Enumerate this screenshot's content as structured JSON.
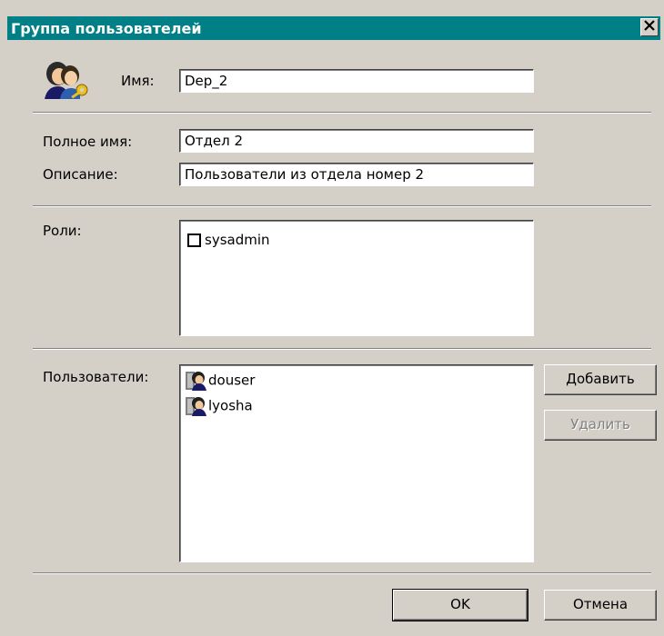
{
  "window": {
    "title": "Группа пользователей",
    "close_label": "×"
  },
  "form": {
    "name_label": "Имя:",
    "name_value": "Dep_2",
    "fullname_label": "Полное имя:",
    "fullname_value": "Отдел 2",
    "description_label": "Описание:",
    "description_value": "Пользователи из отдела номер 2",
    "roles_label": "Роли:",
    "roles": [
      {
        "label": "sysadmin",
        "checked": false
      }
    ],
    "users_label": "Пользователи:",
    "users": [
      {
        "label": "douser"
      },
      {
        "label": "lyosha"
      }
    ]
  },
  "buttons": {
    "add": "Добавить",
    "remove": "Удалить",
    "ok": "OK",
    "cancel": "Отмена"
  }
}
